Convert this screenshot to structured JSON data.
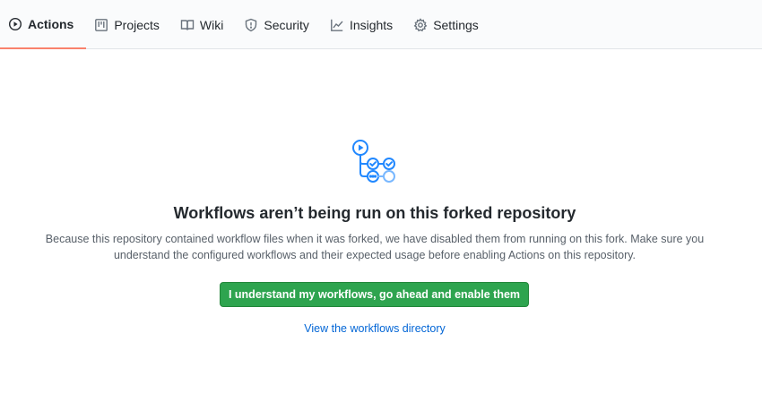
{
  "tabs": [
    {
      "label": "Actions",
      "icon": "play-circle-icon",
      "selected": true
    },
    {
      "label": "Projects",
      "icon": "project-board-icon",
      "selected": false
    },
    {
      "label": "Wiki",
      "icon": "book-icon",
      "selected": false
    },
    {
      "label": "Security",
      "icon": "shield-icon",
      "selected": false
    },
    {
      "label": "Insights",
      "icon": "graph-icon",
      "selected": false
    },
    {
      "label": "Settings",
      "icon": "gear-icon",
      "selected": false
    }
  ],
  "blankslate": {
    "illustration_icon": "workflow-illustration-icon",
    "title": "Workflows aren’t being run on this forked repository",
    "description": "Because this repository contained workflow files when it was forked, we have disabled them from running on this fork. Make sure you understand the configured workflows and their expected usage before enabling Actions on this repository.",
    "enable_button": "I understand my workflows, go ahead and enable them",
    "directory_link": "View the workflows directory"
  },
  "colors": {
    "accent_tab": "#f9826c",
    "primary_button": "#2ea44f",
    "link": "#0366d6",
    "illustration": "#2188ff"
  }
}
